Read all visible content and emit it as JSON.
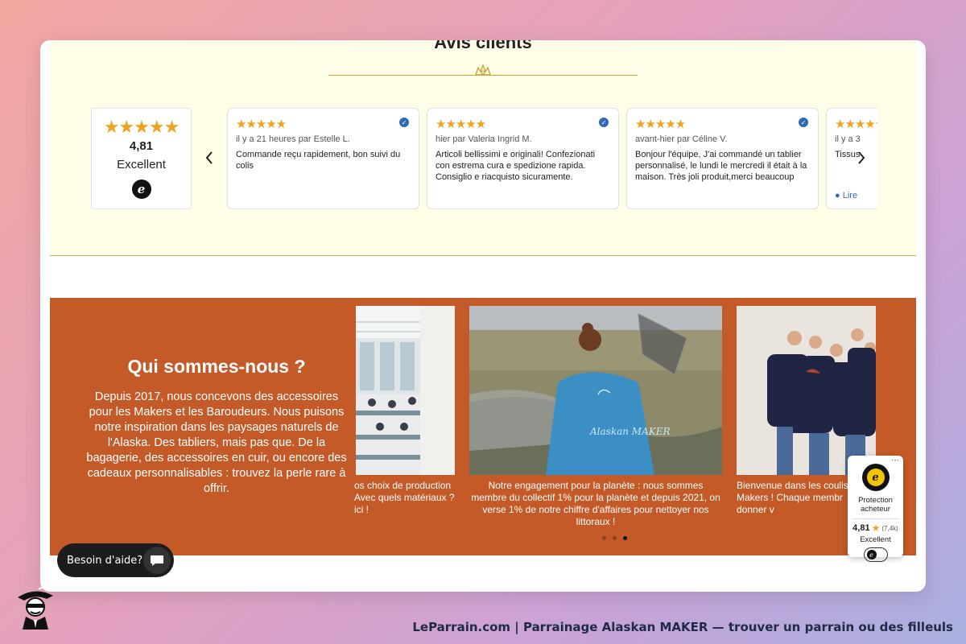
{
  "reviews": {
    "section_title": "Avis clients",
    "summary": {
      "stars": "★★★★★",
      "score": "4,81",
      "label": "Excellent"
    },
    "items": [
      {
        "stars": "★★★★★",
        "meta": "il y a 21 heures par Estelle L.",
        "text": "Commande reçu rapidement, bon suivi du colis"
      },
      {
        "stars": "★★★★★",
        "meta": "hier par Valeria Ingrid M.",
        "text": "Articoli bellissimi e originali! Confezionati con estrema cura e spedizione rapida. Consiglio e riacquisto sicuramente."
      },
      {
        "stars": "★★★★★",
        "meta": "avant-hier par Céline V.",
        "text": "Bonjour l'équipe, J'ai commandé un tablier personnalisé, le lundi le mercredi il était à la maison. Très joli produit,merci beaucoup"
      },
      {
        "stars": "★★★★★",
        "meta": "il y a 3",
        "text": "Tissus",
        "read_more": "Lire"
      }
    ]
  },
  "about": {
    "title": "Qui sommes-nous ?",
    "text": "Depuis 2017, nous concevons des accessoires pour les Makers et les Baroudeurs. Nous puisons notre inspiration dans les paysages naturels de l'Alaska. Des tabliers, mais pas que. De la bagagerie, des accessoires en cuir, ou encore des cadeaux personnalisables : trouvez la perle rare à offrir.",
    "slides": [
      {
        "caption": "os choix de production\nAvec quels matériaux ?\nici !"
      },
      {
        "caption": "Notre engagement pour la planète : nous sommes membre du collectif 1% pour la planète et depuis 2021, on verse 1% de notre chiffre d'affaires pour nettoyer nos littoraux !",
        "shirt_text": "Alaskan MAKER"
      },
      {
        "caption": "Bienvenue dans les coulis\nMakers ! Chaque membr\ndonner v"
      }
    ],
    "active_slide": 3,
    "slide_count": 3
  },
  "help_widget": {
    "label": "Besoin d'aide?"
  },
  "trusted_badge": {
    "more": "···",
    "label": "Protection acheteur",
    "score": "4,81",
    "count": "(7,4k)",
    "rating_label": "Excellent"
  },
  "footer": {
    "text": "LeParrain.com | Parrainage Alaskan MAKER — trouver un parrain ou des filleuls"
  },
  "colors": {
    "accent": "#c45a27",
    "star": "#f0a21c",
    "reviews_bg": "#fdfde8"
  }
}
